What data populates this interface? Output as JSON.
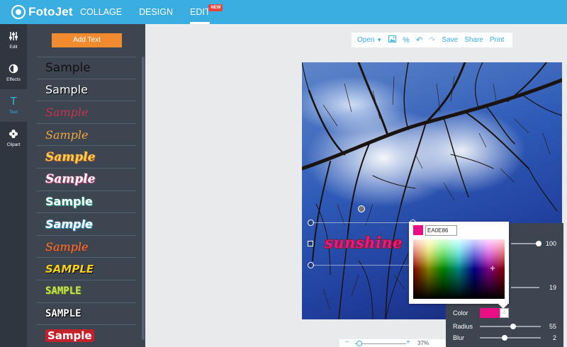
{
  "app": {
    "logo_text": "FotoJet"
  },
  "nav": {
    "items": [
      {
        "label": "COLLAGE"
      },
      {
        "label": "DESIGN"
      },
      {
        "label": "EDIT",
        "badge": "NEW"
      }
    ]
  },
  "rail": {
    "items": [
      {
        "label": "Edit",
        "icon": "sliders-icon"
      },
      {
        "label": "Effects",
        "icon": "contrast-icon"
      },
      {
        "label": "Text",
        "icon": "text-icon"
      },
      {
        "label": "Clipart",
        "icon": "flower-icon"
      }
    ],
    "active": "Text"
  },
  "panel": {
    "add_text_label": "Add Text",
    "samples": [
      "Sample",
      "Sample",
      "Sample",
      "Sample",
      "Sample",
      "Sample",
      "Sample",
      "Sample",
      "Sample",
      "SAMPLE",
      "SAMPLE",
      "SAMPLE",
      "Sample"
    ]
  },
  "toolbar": {
    "open_label": "Open",
    "save_label": "Save",
    "share_label": "Share",
    "print_label": "Print"
  },
  "canvas": {
    "text_layer": "sunshine"
  },
  "picker": {
    "hex_value": "EA0E86",
    "color": "#ea0e86"
  },
  "settings": {
    "opacity_value": "100",
    "opacity_level": 1.0,
    "size_value": "19",
    "color_label": "Color",
    "radius_label": "Radius",
    "radius_value": "55",
    "radius_level": 0.55,
    "blur_label": "Blur",
    "blur_value": "2",
    "blur_level": 0.43
  },
  "zoom": {
    "value": "37%"
  },
  "colors": {
    "accent": "#3aaee0",
    "topbar": "#3aaee0",
    "button": "#f08b2f",
    "panel": "#3d4550",
    "rail": "#2f3640",
    "text_color": "#ea0e86"
  }
}
